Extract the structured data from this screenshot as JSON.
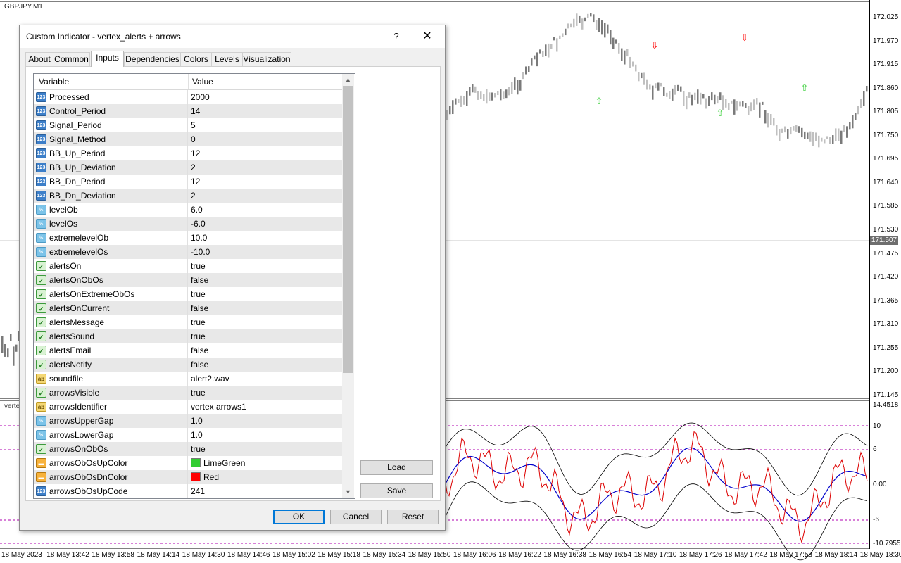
{
  "chart": {
    "title": "GBPJPY,M1",
    "subwindow_title": "vertex",
    "current_price": "171.507",
    "price_labels": [
      "172.025",
      "171.970",
      "171.915",
      "171.860",
      "171.805",
      "171.750",
      "171.695",
      "171.640",
      "171.585",
      "171.530",
      "171.475",
      "171.420",
      "171.365",
      "171.310",
      "171.255",
      "171.200",
      "171.145"
    ],
    "indicator_labels": [
      "14.4518",
      "10",
      "6",
      "0.00",
      "-6",
      "-10.7955"
    ],
    "time_labels": [
      "18 May 2023",
      "18 May 13:42",
      "18 May 13:58",
      "18 May 14:14",
      "18 May 14:30",
      "18 May 14:46",
      "18 May 15:02",
      "18 May 15:18",
      "18 May 15:34",
      "18 May 15:50",
      "18 May 16:06",
      "18 May 16:22",
      "18 May 16:38",
      "18 May 16:54",
      "18 May 17:10",
      "18 May 17:26",
      "18 May 17:42",
      "18 May 17:58",
      "18 May 18:14",
      "18 May 18:30"
    ],
    "colors": {
      "up_arrow": "#32cd32",
      "down_arrow": "#ff0000",
      "level_line": "#b000b0",
      "signal_line": "#0000cc",
      "main_line": "#dd0000",
      "band_line": "#000000",
      "candle": "#808080"
    }
  },
  "dialog": {
    "title": "Custom Indicator - vertex_alerts + arrows",
    "help_label": "?",
    "close_icon": "✕",
    "tabs": [
      "About",
      "Common",
      "Inputs",
      "Dependencies",
      "Colors",
      "Levels",
      "Visualization"
    ],
    "active_tab": "Inputs",
    "columns": {
      "variable": "Variable",
      "value": "Value"
    },
    "rows": [
      {
        "name": "Processed",
        "value": "2000",
        "type": "num",
        "icon": "123"
      },
      {
        "name": "Control_Period",
        "value": "14",
        "type": "num",
        "icon": "123"
      },
      {
        "name": "Signal_Period",
        "value": "5",
        "type": "num",
        "icon": "123"
      },
      {
        "name": "Signal_Method",
        "value": "0",
        "type": "num",
        "icon": "123"
      },
      {
        "name": "BB_Up_Period",
        "value": "12",
        "type": "num",
        "icon": "123"
      },
      {
        "name": "BB_Up_Deviation",
        "value": "2",
        "type": "num",
        "icon": "123"
      },
      {
        "name": "BB_Dn_Period",
        "value": "12",
        "type": "num",
        "icon": "123"
      },
      {
        "name": "BB_Dn_Deviation",
        "value": "2",
        "type": "num",
        "icon": "123"
      },
      {
        "name": "levelOb",
        "value": "6.0",
        "type": "dbl",
        "icon": "½"
      },
      {
        "name": "levelOs",
        "value": "-6.0",
        "type": "dbl",
        "icon": "½"
      },
      {
        "name": "extremelevelOb",
        "value": "10.0",
        "type": "dbl",
        "icon": "½"
      },
      {
        "name": "extremelevelOs",
        "value": "-10.0",
        "type": "dbl",
        "icon": "½"
      },
      {
        "name": "alertsOn",
        "value": "true",
        "type": "bool",
        "icon": "✓"
      },
      {
        "name": "alertsOnObOs",
        "value": "false",
        "type": "bool",
        "icon": "✓"
      },
      {
        "name": "alertsOnExtremeObOs",
        "value": "true",
        "type": "bool",
        "icon": "✓"
      },
      {
        "name": "alertsOnCurrent",
        "value": "false",
        "type": "bool",
        "icon": "✓"
      },
      {
        "name": "alertsMessage",
        "value": "true",
        "type": "bool",
        "icon": "✓"
      },
      {
        "name": "alertsSound",
        "value": "true",
        "type": "bool",
        "icon": "✓"
      },
      {
        "name": "alertsEmail",
        "value": "false",
        "type": "bool",
        "icon": "✓"
      },
      {
        "name": "alertsNotify",
        "value": "false",
        "type": "bool",
        "icon": "✓"
      },
      {
        "name": "soundfile",
        "value": "alert2.wav",
        "type": "str",
        "icon": "ab"
      },
      {
        "name": "arrowsVisible",
        "value": "true",
        "type": "bool",
        "icon": "✓"
      },
      {
        "name": "arrowsIdentifier",
        "value": "vertex arrows1",
        "type": "str",
        "icon": "ab"
      },
      {
        "name": "arrowsUpperGap",
        "value": "1.0",
        "type": "dbl",
        "icon": "½"
      },
      {
        "name": "arrowsLowerGap",
        "value": "1.0",
        "type": "dbl",
        "icon": "½"
      },
      {
        "name": "arrowsOnObOs",
        "value": "true",
        "type": "bool",
        "icon": "✓"
      },
      {
        "name": "arrowsObOsUpColor",
        "value": "LimeGreen",
        "type": "col",
        "icon": "▬",
        "swatch": "#32cd32"
      },
      {
        "name": "arrowsObOsDnColor",
        "value": "Red",
        "type": "col",
        "icon": "▬",
        "swatch": "#ff0000"
      },
      {
        "name": "arrowsObOsUpCode",
        "value": "241",
        "type": "num",
        "icon": "123"
      }
    ],
    "side_buttons": {
      "load": "Load",
      "save": "Save"
    },
    "buttons": {
      "ok": "OK",
      "cancel": "Cancel",
      "reset": "Reset"
    }
  }
}
